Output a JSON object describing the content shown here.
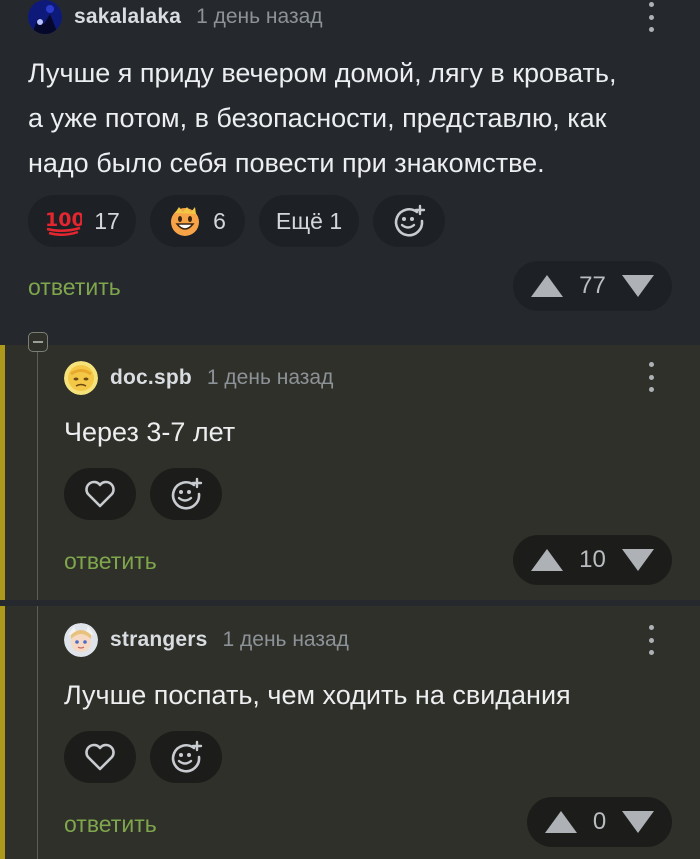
{
  "comments": [
    {
      "username": "sakalalaka",
      "time": "1 день назад",
      "text_lines": [
        "Лучше я приду вечером домой, лягу в кровать,",
        "а уже потом, в безопасности, представлю, как",
        "надо было себя повести при знакомстве."
      ],
      "reactions": [
        {
          "icon": "hundred-points-icon",
          "count": "17"
        },
        {
          "icon": "grinning-face-icon",
          "count": "6"
        }
      ],
      "more_reactions": "Ещё 1",
      "reply_label": "ответить",
      "rating": "77"
    },
    {
      "username": "doc.spb",
      "time": "1 день назад",
      "text": "Через 3-7 лет",
      "reply_label": "ответить",
      "rating": "10"
    },
    {
      "username": "strangers",
      "time": "1 день назад",
      "text": "Лучше поспать, чем ходить на свидания",
      "reply_label": "ответить",
      "rating": "0"
    }
  ],
  "colors": {
    "accent_bar": "#ae9a1a",
    "reply": "#7fa64c",
    "background": "#25292e",
    "nested_background": "#2e3029"
  }
}
